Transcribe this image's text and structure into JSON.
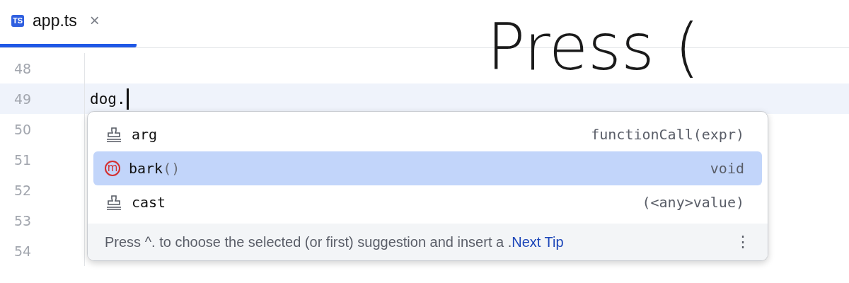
{
  "tabs": [
    {
      "badge": "TS",
      "label": "app.ts",
      "close": "×",
      "selected": true
    }
  ],
  "overlay_caption": "Press (",
  "editor": {
    "lines": [
      {
        "number": "48",
        "current": false
      },
      {
        "number": "49",
        "code": "dog.",
        "current": true
      },
      {
        "number": "50",
        "current": false
      },
      {
        "number": "51",
        "current": false
      },
      {
        "number": "52",
        "current": false
      },
      {
        "number": "53",
        "current": false
      },
      {
        "number": "54",
        "current": false
      }
    ]
  },
  "completion": {
    "items": [
      {
        "kind": "template",
        "name": "arg",
        "type": "functionCall(expr)",
        "selected": false
      },
      {
        "kind": "method",
        "icon_letter": "m",
        "name": "bark",
        "suffix": "()",
        "type": "void",
        "selected": true
      },
      {
        "kind": "template",
        "name": "cast",
        "type": "(<any>value)",
        "selected": false
      }
    ],
    "footer": {
      "hint": "Press ^. to choose the selected (or first) suggestion and insert a .",
      "link": "Next Tip",
      "menu": "⋮"
    }
  }
}
